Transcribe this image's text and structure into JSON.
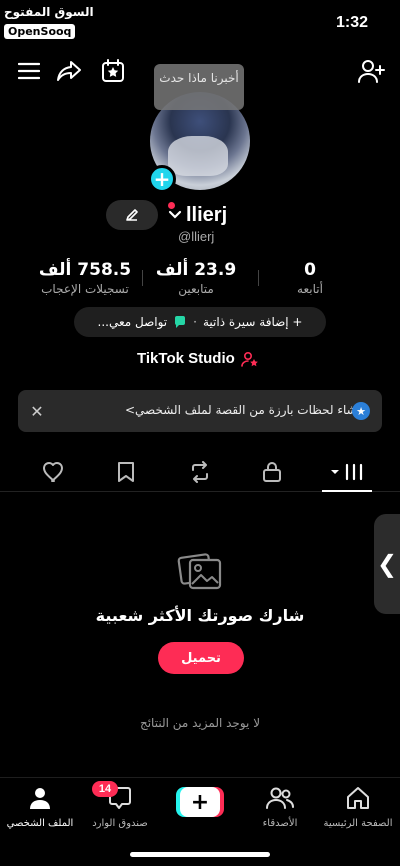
{
  "status_bar": {
    "watermark_line1": "السوق المفتوح",
    "watermark_line2": "OpenSooq",
    "time": "1:32"
  },
  "top_bar": {
    "icons": [
      "menu-icon",
      "share-icon",
      "calendar-star-icon",
      "add-friend-icon"
    ],
    "note_tooltip": "أخبرنا ماذا حدث"
  },
  "profile": {
    "display_name": "llierj",
    "username": "@llierj",
    "edit_icon": "pencil-icon"
  },
  "stats": [
    {
      "value": "0",
      "label": "أتابعه"
    },
    {
      "value": "23.9 ألف",
      "label": "متابعين"
    },
    {
      "value": "758.5 ألف",
      "label": "تسجيلات الإعجاب"
    }
  ],
  "bio": {
    "add_bio": "+ إضافة سيرة ذاتية",
    "contact": "تواصل معي..."
  },
  "studio_label": "TikTok Studio",
  "banner": {
    "text": "إنشاء لحظات بارزة من القصة لملف الشخصي>"
  },
  "tabs": [
    "videos-grid-icon",
    "lock-icon",
    "repost-icon",
    "bookmark-icon",
    "heart-icon"
  ],
  "empty_state": {
    "title": "شارك صورتك الأكثر شعبية",
    "button": "تحميل",
    "no_more": "لا يوجد المزيد من النتائج"
  },
  "bottom_nav": {
    "home": "الصفحة الرئيسية",
    "friends": "الأصدقاء",
    "inbox": "صندوق الوارد",
    "inbox_badge": "14",
    "profile": "الملف الشخصي"
  },
  "colors": {
    "accent": "#fe2c55",
    "cyan": "#20d5ec",
    "background": "#000000"
  }
}
